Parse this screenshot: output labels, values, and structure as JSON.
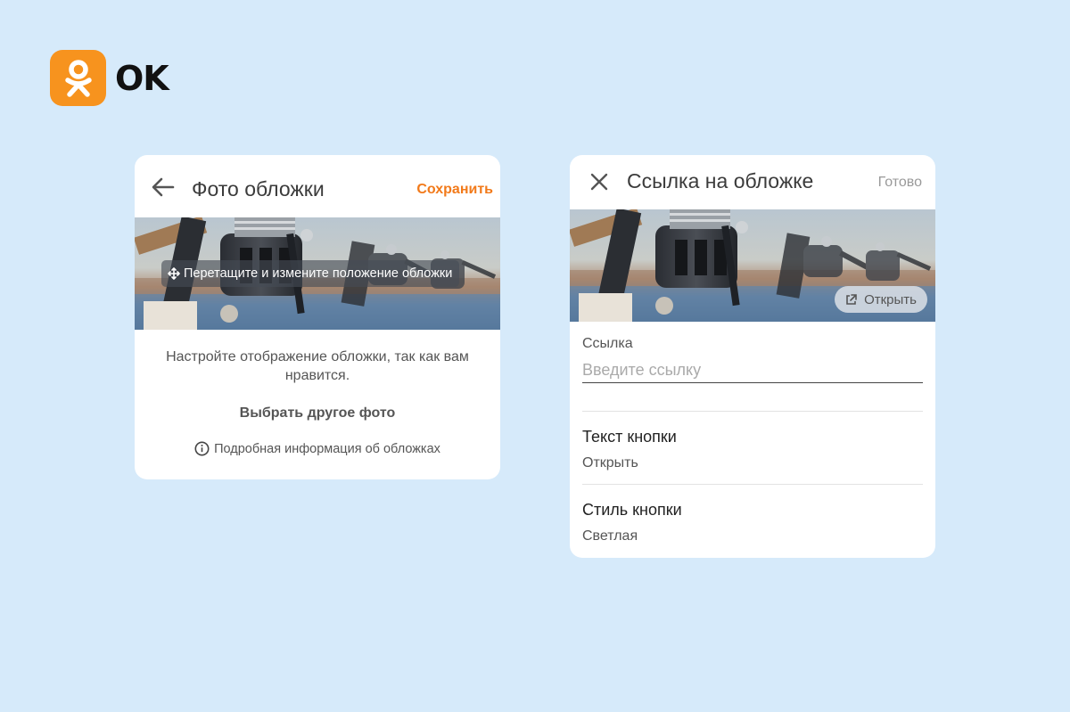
{
  "logo": {
    "text": "OK",
    "brand_color": "#f7931e",
    "icon": "odnoklassniki-logo-icon"
  },
  "cover_editor": {
    "header": {
      "back_icon": "arrow-left-icon",
      "title": "Фото обложки",
      "save_label": "Сохранить"
    },
    "cover": {
      "drag_icon": "move-arrows-icon",
      "drag_hint": "Перетащите и измените положение обложки"
    },
    "description": "Настройте отображение обложки, так как вам нравится.",
    "choose_photo_label": "Выбрать другое фото",
    "info": {
      "icon": "info-icon",
      "label": "Подробная информация об обложках"
    }
  },
  "cover_link": {
    "header": {
      "close_icon": "close-icon",
      "title": "Ссылка на обложке",
      "done_label": "Готово"
    },
    "cover": {
      "open_icon": "external-link-icon",
      "open_label": "Открыть"
    },
    "link": {
      "label": "Ссылка",
      "value": "",
      "placeholder": "Введите ссылку"
    },
    "button_text": {
      "title": "Текст кнопки",
      "value": "Открыть"
    },
    "button_style": {
      "title": "Стиль кнопки",
      "value": "Светлая"
    }
  },
  "colors": {
    "page_background": "#d6eafa",
    "accent": "#f27a1a",
    "card": "#ffffff"
  }
}
